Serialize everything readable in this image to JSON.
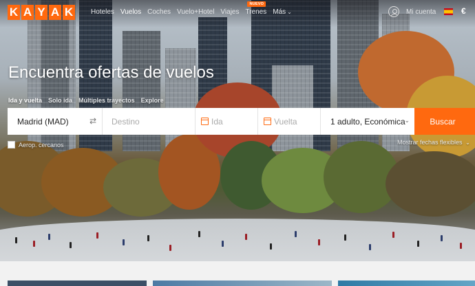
{
  "brand": {
    "logo_letters": [
      "K",
      "A",
      "Y",
      "A",
      "K"
    ],
    "accent_color": "#ff690f"
  },
  "nav": {
    "links": [
      {
        "label": "Hoteles",
        "active": false
      },
      {
        "label": "Vuelos",
        "active": true
      },
      {
        "label": "Coches",
        "active": false
      },
      {
        "label": "Vuelo+Hotel",
        "active": false
      },
      {
        "label": "Viajes",
        "active": false
      },
      {
        "label": "Trenes",
        "active": false,
        "badge": "NUEVO"
      },
      {
        "label": "Más",
        "active": false
      }
    ],
    "account_label": "Mi cuenta",
    "language_flag": "spain-flag-icon",
    "currency": "€"
  },
  "hero": {
    "headline": "Encuentra ofertas de vuelos",
    "trip_tabs": [
      {
        "label": "Ida y vuelta",
        "active": true
      },
      {
        "label": "Solo ida",
        "active": false
      },
      {
        "label": "Múltiples trayectos",
        "active": false
      },
      {
        "label": "Explore",
        "active": false
      }
    ]
  },
  "search": {
    "origin_value": "Madrid (MAD)",
    "destination_placeholder": "Destino",
    "departure_placeholder": "Ida",
    "return_placeholder": "Vuelta",
    "passengers_value": "1 adulto, Económica",
    "search_button": "Buscar",
    "nearby_airports_label": "Aerop. cercanos",
    "nearby_airports_checked": false,
    "flexible_dates_label": "Mostrar fechas flexibles"
  }
}
